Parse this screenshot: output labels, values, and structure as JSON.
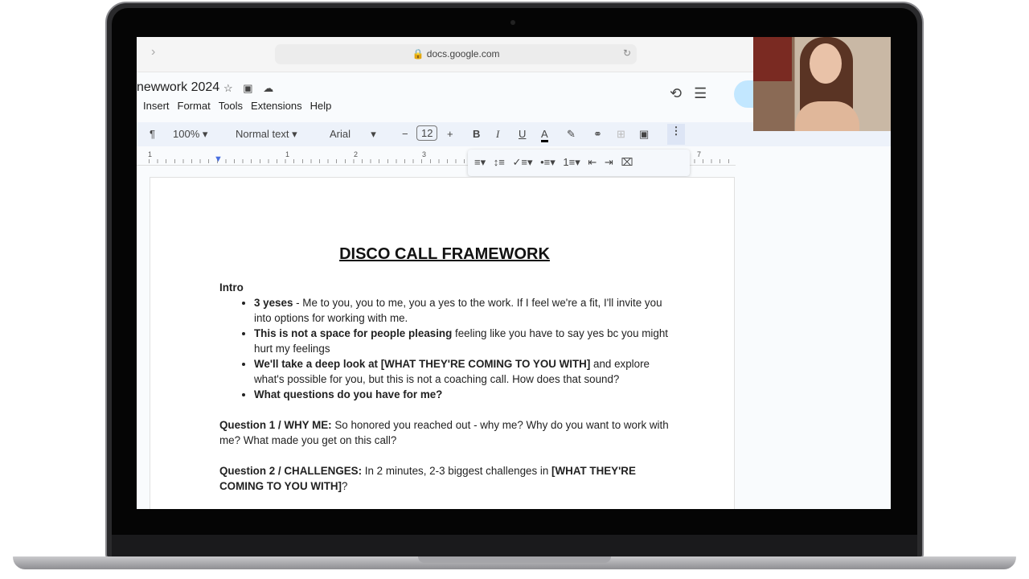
{
  "browser": {
    "url": "docs.google.com"
  },
  "doc_title": "newwork 2024",
  "menu": [
    "Insert",
    "Format",
    "Tools",
    "Extensions",
    "Help"
  ],
  "toolbar": {
    "zoom": "100%",
    "style": "Normal text",
    "font": "Arial",
    "font_size": "12",
    "bold": "B",
    "italic": "I",
    "underline": "U",
    "text_color": "A"
  },
  "ruler": [
    "1",
    "1",
    "2",
    "3",
    "7"
  ],
  "document": {
    "heading": "DISCO CALL FRAMEWORK",
    "intro_label": "Intro",
    "bullets": [
      {
        "bold": "3 yeses",
        "text": " - Me to you, you to me, you a yes to the work. If I feel we're a fit, I'll invite you into options for working with me."
      },
      {
        "bold": "This is not a space for people pleasing",
        "text": " feeling like you have to say yes bc you might hurt my feelings"
      },
      {
        "bold": "We'll take a deep look at [WHAT THEY'RE COMING TO YOU WITH]",
        "text": " and explore what's possible for you, but this is not a coaching call. How does that sound?"
      },
      {
        "bold": "What questions do you have for me?",
        "text": ""
      }
    ],
    "q1": {
      "bold": "Question 1 / WHY ME:",
      "text": " So honored you reached out - why me? Why do you want to work with me? What made you get on this call?"
    },
    "q2": {
      "bold": "Question 2 / CHALLENGES:",
      "text": " In 2 minutes, 2-3 biggest challenges in ",
      "bold2": "[WHAT THEY'RE COMING TO YOU WITH]",
      "end": "?"
    }
  }
}
